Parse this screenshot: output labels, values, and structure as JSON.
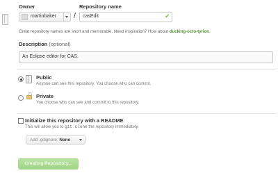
{
  "owner": {
    "label": "Owner",
    "selected": "martinbaker"
  },
  "repository": {
    "label": "Repository name",
    "separator": "/",
    "value": "casEdit"
  },
  "hint": {
    "text": "Great repository names are short and memorable. Need inspiration? How about",
    "suggestion": "ducking-octo-tyrion",
    "end": "."
  },
  "description": {
    "label": "Description",
    "optional": "(optional)",
    "value": "An Eclipse editor for CAS."
  },
  "visibility": {
    "public": {
      "title": "Public",
      "description": "Anyone can see this repository. You choose who can commit."
    },
    "private": {
      "title": "Private",
      "description": "You choose who can see and commit to this repository."
    }
  },
  "readme": {
    "title": "Initialize this repository with a README",
    "desc_before": "This will allow you to",
    "command": "git clone",
    "desc_after": "the repository immediately."
  },
  "gitignore": {
    "prefix": "Add .gitignore:",
    "value": "None"
  },
  "create_button": "Creating Repository...",
  "colors": {
    "check": "#6cc644",
    "suggestion": "#4a8b2a",
    "button": "#a0d486"
  }
}
